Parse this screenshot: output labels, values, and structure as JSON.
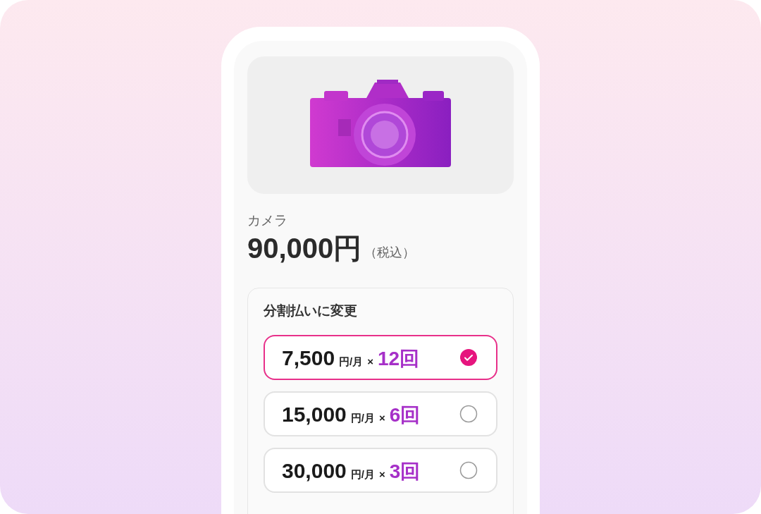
{
  "product": {
    "name": "カメラ",
    "price": "90,000円",
    "tax_note": "（税込）"
  },
  "installments": {
    "title": "分割払いに変更",
    "options": [
      {
        "amount": "7,500",
        "unit": "円/月",
        "times": "×",
        "count": "12回",
        "selected": true
      },
      {
        "amount": "15,000",
        "unit": "円/月",
        "times": "×",
        "count": "6回",
        "selected": false
      },
      {
        "amount": "30,000",
        "unit": "円/月",
        "times": "×",
        "count": "3回",
        "selected": false
      }
    ]
  }
}
